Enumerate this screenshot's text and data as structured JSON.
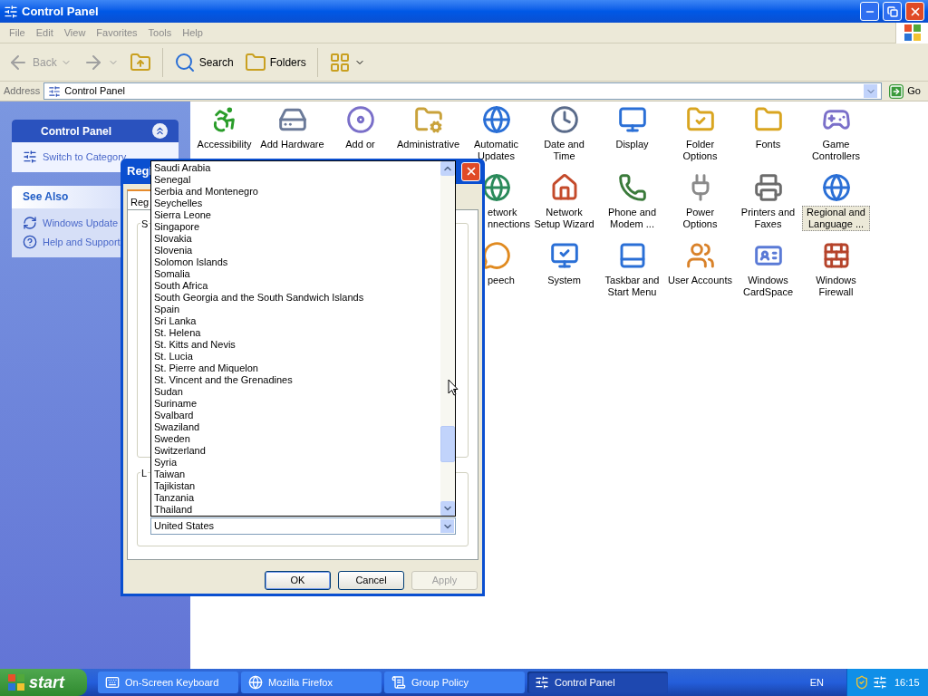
{
  "window": {
    "title": "Control Panel"
  },
  "menu": [
    "File",
    "Edit",
    "View",
    "Favorites",
    "Tools",
    "Help"
  ],
  "toolbar": [
    {
      "kind": "back",
      "label": "Back",
      "disabled": true
    },
    {
      "kind": "forward",
      "disabled": true
    },
    {
      "kind": "up",
      "disabled": false
    },
    {
      "kind": "search",
      "label": "Search",
      "disabled": false
    },
    {
      "kind": "folders",
      "label": "Folders",
      "disabled": false
    },
    {
      "kind": "views",
      "disabled": false
    }
  ],
  "address": {
    "label": "Address",
    "value": "Control Panel",
    "go": "Go"
  },
  "sidebar": [
    {
      "title": "Control Panel",
      "kind": "special",
      "links": [
        "Switch to Category"
      ]
    },
    {
      "title": "See Also",
      "kind": "normal",
      "links": [
        "Windows Update",
        "Help and Support"
      ]
    }
  ],
  "icons": [
    [
      {
        "label": "Accessibility",
        "selected": false
      },
      {
        "label": "Add Hardware",
        "selected": false
      },
      {
        "label": "Add or",
        "selected": false
      },
      {
        "label": "Administrative",
        "selected": false
      },
      {
        "label": "Automatic Updates",
        "selected": false
      },
      {
        "label": "Date and Time",
        "selected": false
      },
      {
        "label": "Display",
        "selected": false
      },
      {
        "label": "Folder Options",
        "selected": false
      },
      {
        "label": "Fonts",
        "selected": false
      },
      {
        "label": "Game Controllers",
        "selected": false
      }
    ],
    [
      {
        "label": "etwork nnections",
        "selected": false
      },
      {
        "label": "Network Setup Wizard",
        "selected": false
      },
      {
        "label": "Phone and Modem ...",
        "selected": false
      },
      {
        "label": "Power Options",
        "selected": false
      },
      {
        "label": "Printers and Faxes",
        "selected": false
      },
      {
        "label": "Regional and Language ...",
        "selected": true
      }
    ],
    [
      {
        "label": "peech",
        "selected": false
      },
      {
        "label": "System",
        "selected": false
      },
      {
        "label": "Taskbar and Start Menu",
        "selected": false
      },
      {
        "label": "User Accounts",
        "selected": false
      },
      {
        "label": "Windows CardSpace",
        "selected": false
      },
      {
        "label": "Windows Firewall",
        "selected": false
      }
    ]
  ],
  "dialog": {
    "title": "Regi",
    "tab": "Reg",
    "group_labels": [
      "S",
      "L"
    ],
    "list": [
      "Saudi Arabia",
      "Senegal",
      "Serbia and Montenegro",
      "Seychelles",
      "Sierra Leone",
      "Singapore",
      "Slovakia",
      "Slovenia",
      "Solomon Islands",
      "Somalia",
      "South Africa",
      "South Georgia and the South Sandwich Islands",
      "Spain",
      "Sri Lanka",
      "St. Helena",
      "St. Kitts and Nevis",
      "St. Lucia",
      "St. Pierre and Miquelon",
      "St. Vincent and the Grenadines",
      "Sudan",
      "Suriname",
      "Svalbard",
      "Swaziland",
      "Sweden",
      "Switzerland",
      "Syria",
      "Taiwan",
      "Tajikistan",
      "Tanzania",
      "Thailand"
    ],
    "combo": "United States",
    "buttons": [
      {
        "label": "OK",
        "disabled": false
      },
      {
        "label": "Cancel",
        "disabled": false
      },
      {
        "label": "Apply",
        "disabled": true
      }
    ]
  },
  "taskbar": {
    "start": "start",
    "tasks": [
      {
        "label": "On-Screen Keyboard",
        "selected": false
      },
      {
        "label": "Mozilla Firefox",
        "selected": false
      },
      {
        "label": "Group Policy",
        "selected": false
      },
      {
        "label": "Control Panel",
        "selected": true
      }
    ],
    "language": "EN",
    "clock": "16:15"
  }
}
